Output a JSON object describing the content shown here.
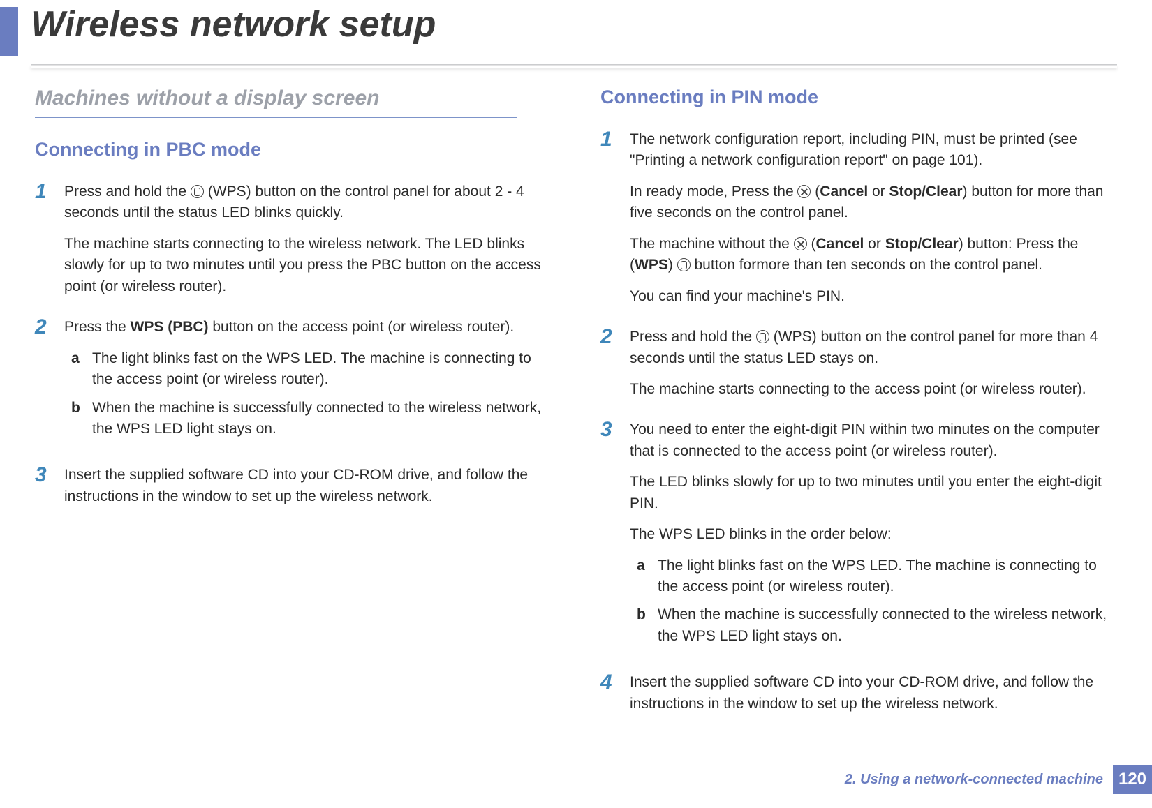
{
  "header": {
    "title": "Wireless network setup"
  },
  "left": {
    "section_title": "Machines without a display screen",
    "subheading": "Connecting in PBC mode",
    "steps": [
      {
        "num": "1",
        "paras": [
          {
            "segments": [
              {
                "t": "Press and hold the "
              },
              {
                "icon": "wps"
              },
              {
                "t": " (WPS) button on the control panel for about 2 - 4 seconds until the status LED blinks quickly."
              }
            ]
          },
          {
            "segments": [
              {
                "t": "The machine starts connecting to the wireless network. The LED blinks slowly for up to two minutes until you press the PBC button on the access point (or wireless router)."
              }
            ]
          }
        ]
      },
      {
        "num": "2",
        "paras": [
          {
            "segments": [
              {
                "t": "Press the "
              },
              {
                "t": "WPS (PBC)",
                "b": true
              },
              {
                "t": " button on the access point (or wireless router)."
              }
            ]
          }
        ],
        "subs": [
          {
            "letter": "a",
            "text": "The light blinks fast on the WPS LED. The machine is connecting to the access point (or wireless router)."
          },
          {
            "letter": "b",
            "text": "When the machine is successfully connected to the wireless network, the WPS LED light stays on."
          }
        ]
      },
      {
        "num": "3",
        "paras": [
          {
            "segments": [
              {
                "t": "Insert the supplied software CD into your CD-ROM drive, and follow the instructions in the window to set up the wireless network."
              }
            ]
          }
        ]
      }
    ]
  },
  "right": {
    "subheading": "Connecting in PIN mode",
    "steps": [
      {
        "num": "1",
        "paras": [
          {
            "segments": [
              {
                "t": "The network configuration report, including PIN, must be printed (see \"Printing a network configuration report\" on page 101)."
              }
            ]
          },
          {
            "segments": [
              {
                "t": "In ready mode, Press the "
              },
              {
                "icon": "cancel"
              },
              {
                "t": " ("
              },
              {
                "t": "Cancel",
                "b": true
              },
              {
                "t": " or "
              },
              {
                "t": "Stop/Clear",
                "b": true
              },
              {
                "t": ") button for more than five seconds on the control panel."
              }
            ]
          },
          {
            "segments": [
              {
                "t": "The machine without the "
              },
              {
                "icon": "cancel"
              },
              {
                "t": " ("
              },
              {
                "t": "Cancel",
                "b": true
              },
              {
                "t": " or "
              },
              {
                "t": "Stop/Clear",
                "b": true
              },
              {
                "t": ") button: Press the ("
              },
              {
                "t": "WPS",
                "b": true
              },
              {
                "t": ") "
              },
              {
                "icon": "wps"
              },
              {
                "t": " button formore than ten seconds on the control panel."
              }
            ]
          },
          {
            "segments": [
              {
                "t": "You can find your machine's PIN."
              }
            ]
          }
        ]
      },
      {
        "num": "2",
        "paras": [
          {
            "segments": [
              {
                "t": "Press and hold the "
              },
              {
                "icon": "wps"
              },
              {
                "t": " (WPS) button on the control panel for more than 4 seconds until the status LED stays on."
              }
            ]
          },
          {
            "segments": [
              {
                "t": "The machine starts connecting to the access point (or wireless router)."
              }
            ]
          }
        ]
      },
      {
        "num": "3",
        "paras": [
          {
            "segments": [
              {
                "t": "You need to enter the eight-digit PIN within two minutes on the computer that is connected to the access point (or wireless router)."
              }
            ]
          },
          {
            "segments": [
              {
                "t": "The LED blinks slowly for up to two minutes until you enter the eight-digit PIN."
              }
            ]
          },
          {
            "segments": [
              {
                "t": "The WPS LED blinks in the order below:"
              }
            ]
          }
        ],
        "subs": [
          {
            "letter": "a",
            "text": "The light blinks fast on the WPS LED. The machine is connecting to the access point (or wireless router)."
          },
          {
            "letter": "b",
            "text": "When the machine is successfully connected to the wireless network, the WPS LED light stays on."
          }
        ]
      },
      {
        "num": "4",
        "paras": [
          {
            "segments": [
              {
                "t": "Insert the supplied software CD into your CD-ROM drive, and follow the instructions in the window to set up the wireless network."
              }
            ]
          }
        ]
      }
    ]
  },
  "footer": {
    "text": "2.  Using a network-connected machine",
    "page": "120"
  }
}
